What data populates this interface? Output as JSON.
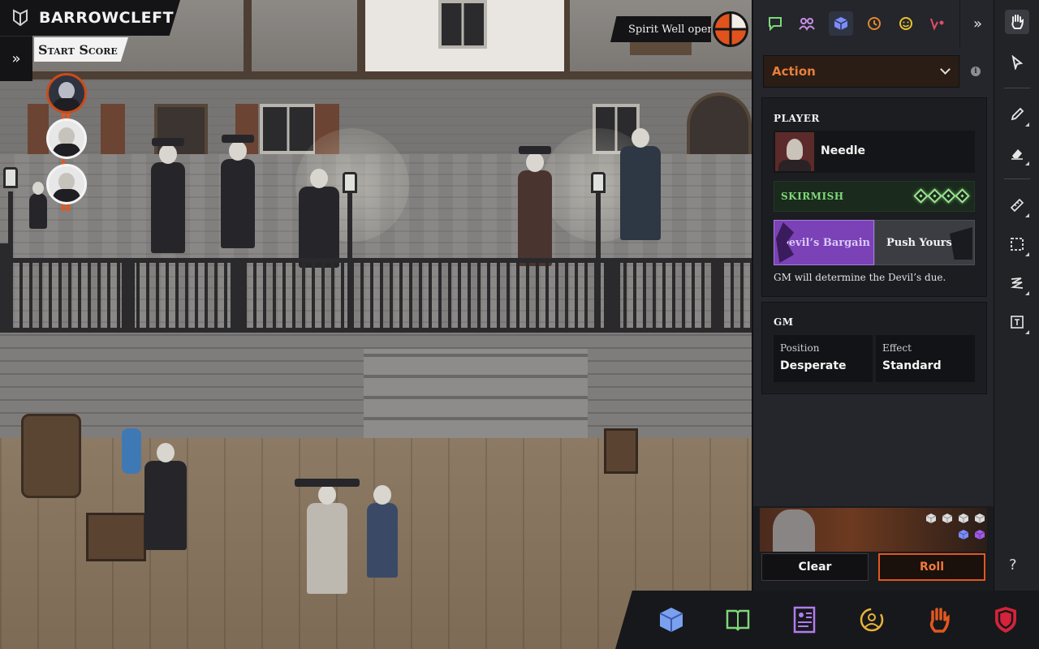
{
  "app": {
    "title": "BARROWCLEFT"
  },
  "score": {
    "label": "Start Score"
  },
  "notification": {
    "text": "Spirit Well opens"
  },
  "panel": {
    "tabs": [
      "chat-icon",
      "party-icon",
      "dice-icon",
      "clock-icon",
      "emote-icon",
      "map-pin-icon"
    ],
    "active_tab": "dice-icon",
    "roll_type": "Action",
    "player": {
      "section_label": "PLAYER",
      "name": "Needle",
      "action": "SKIRMISH",
      "action_rating": 4
    },
    "devils_bargain_label": "Devil’s Bargain",
    "push_yourself_label": "Push Yourself",
    "devils_note": "GM will determine the Devil’s due.",
    "gm": {
      "section_label": "GM",
      "position_label": "Position",
      "position_value": "Desperate",
      "effect_label": "Effect",
      "effect_value": "Standard"
    },
    "dice": {
      "white_count": 4,
      "purple_count": 2
    },
    "clear_label": "Clear",
    "roll_label": "Roll"
  },
  "rail": {
    "tools": [
      "hand-icon",
      "pointer-icon",
      "pencil-icon",
      "eraser-icon",
      "ruler-icon",
      "select-box-icon",
      "scribble-icon",
      "text-box-icon"
    ],
    "help": "?"
  },
  "dock": {
    "buttons": [
      "dice-icon",
      "book-icon",
      "character-sheet-icon",
      "crew-icon",
      "hand-icon",
      "shield-icon"
    ]
  },
  "colors": {
    "accent": "#e2571f",
    "action_text": "#e87e3c",
    "skirmish": "#7fd77a",
    "devils_bargain": "#7a42b6",
    "active_tab": "#7b8cff"
  }
}
